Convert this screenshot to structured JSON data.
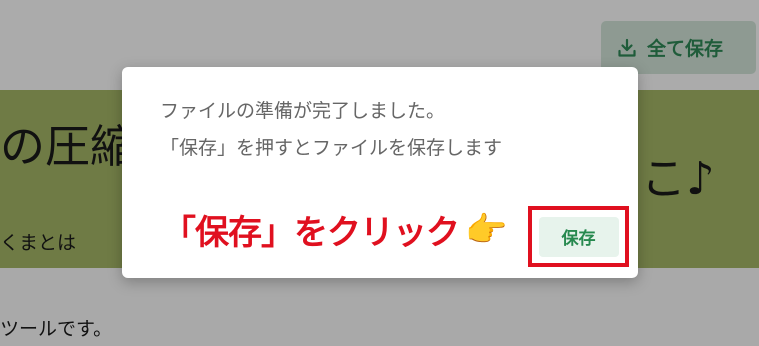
{
  "background_page": {
    "save_all_label": "全て保存",
    "hero_title_left": "の圧縮",
    "hero_title_right": "こ♪",
    "hero_subtitle_left": "くまとは",
    "body_text": "ツールです。"
  },
  "modal": {
    "message_line1": "ファイルの準備が完了しました。",
    "message_line2": "「保存」を押すとファイルを保存します",
    "instruction": "「保存」をクリック",
    "save_label": "保存"
  },
  "colors": {
    "accent_red": "#e0101f",
    "save_green": "#27894f",
    "hero_band": "#6f7b45"
  },
  "icons": {
    "download": "download-icon",
    "pointing": "pointing-hand-icon"
  }
}
